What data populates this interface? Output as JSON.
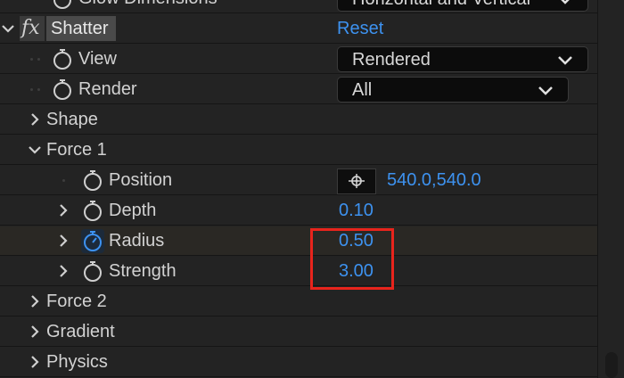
{
  "rows": {
    "glow": {
      "label": "Glow Dimensions",
      "value": "Horizontal and Vertical"
    },
    "shatter": {
      "label": "Shatter",
      "reset": "Reset"
    },
    "view": {
      "label": "View",
      "value": "Rendered"
    },
    "render": {
      "label": "Render",
      "value": "All"
    },
    "shape": {
      "label": "Shape"
    },
    "force1": {
      "label": "Force 1"
    },
    "position": {
      "label": "Position",
      "value": "540.0,540.0"
    },
    "depth": {
      "label": "Depth",
      "value": "0.10"
    },
    "radius": {
      "label": "Radius",
      "value": "0.50"
    },
    "strength": {
      "label": "Strength",
      "value": "3.00"
    },
    "force2": {
      "label": "Force 2"
    },
    "gradient": {
      "label": "Gradient"
    },
    "physics": {
      "label": "Physics"
    }
  },
  "fx_badge": "fx",
  "colors": {
    "value_blue": "#3d92f0",
    "highlight_red": "#e8241c"
  },
  "icons": [
    "stopwatch-icon",
    "twirl-arrow-icon",
    "chevron-down-icon",
    "crosshair-icon"
  ]
}
